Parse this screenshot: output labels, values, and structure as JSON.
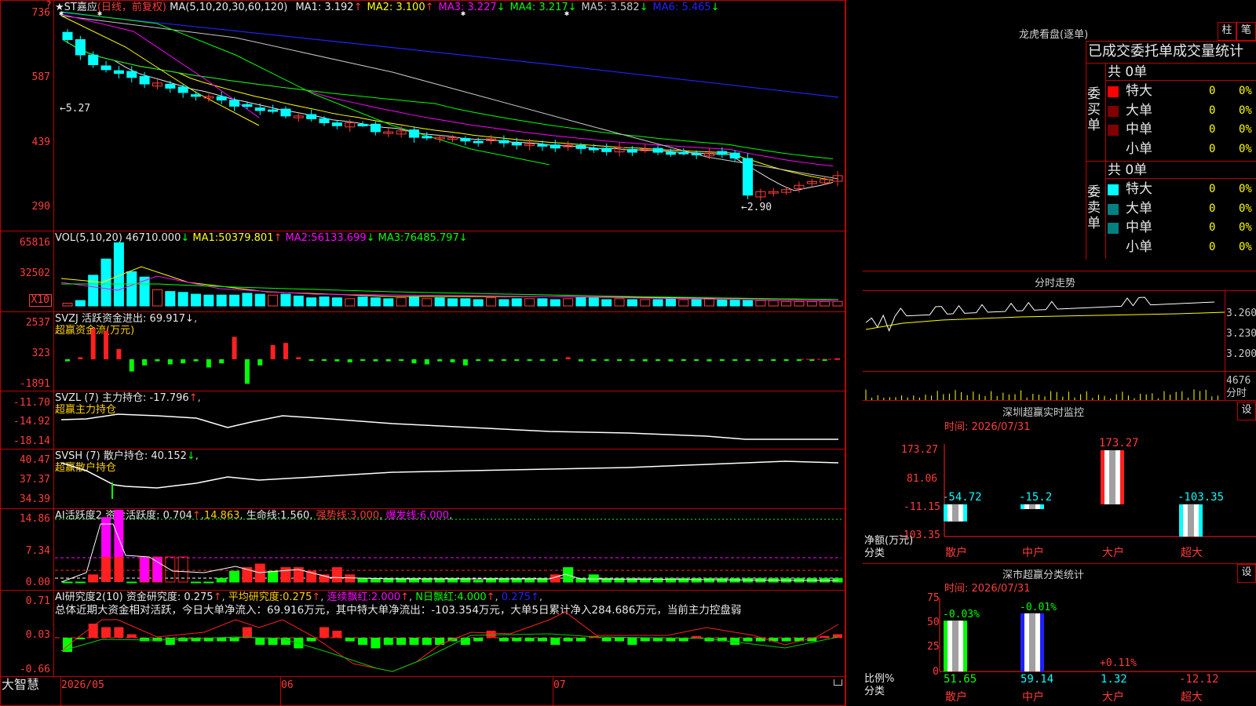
{
  "stock": {
    "title": "★ST嘉应",
    "period": "(日线，前复权)",
    "ma_label": "MA(5,10,20,30,60,120)",
    "ma": [
      {
        "name": "MA1:",
        "val": "3.192",
        "arrow": "↑",
        "color": "#e8e8e8"
      },
      {
        "name": "MA2:",
        "val": "3.100",
        "arrow": "↑",
        "color": "#ffff00"
      },
      {
        "name": "MA3:",
        "val": "3.227",
        "arrow": "↓",
        "color": "#ff00ff"
      },
      {
        "name": "MA4:",
        "val": "3.217",
        "arrow": "↓",
        "color": "#00ff00"
      },
      {
        "name": "MA5:",
        "val": "3.582",
        "arrow": "↓",
        "color": "#c8c8c8"
      },
      {
        "name": "MA6:",
        "val": "5.465",
        "arrow": "↓",
        "color": "#2222ff"
      }
    ],
    "y_ticks": [
      "736",
      "587",
      "439",
      "290"
    ],
    "high_label": "5.27",
    "low_label": "2.90",
    "corner_mark": "?"
  },
  "vol": {
    "label": "VOL(5,10,20)",
    "value": "46710.000",
    "arrow": "↓",
    "ma1": {
      "name": "MA1:",
      "val": "50379.801",
      "arrow": "↑"
    },
    "ma2": {
      "name": "MA2:",
      "val": "56133.699",
      "arrow": "↓"
    },
    "ma3": {
      "name": "MA3:",
      "val": "76485.797",
      "arrow": "↓"
    },
    "y_ticks": [
      "65816",
      "32502"
    ],
    "unit": "X10"
  },
  "svzj": {
    "label": "SVZJ  活跃资金进出:",
    "value": "69.917",
    "arrow": "↓",
    "sub": "超赢资金流(万元)",
    "y_ticks": [
      "2537",
      "323",
      "-1891"
    ]
  },
  "svzl": {
    "label": "SVZL (7) 主力持仓:",
    "value": "-17.796",
    "arrow": "↑",
    "sub": "超赢主力持仓",
    "y_ticks": [
      "-11.70",
      "-14.92",
      "-18.14"
    ]
  },
  "svsh": {
    "label": "SVSH (7) 散户持仓:",
    "value": "40.152",
    "arrow": "↓",
    "sub": "超赢散户持仓",
    "y_ticks": [
      "40.47",
      "37.37",
      "34.39"
    ]
  },
  "ai_active": {
    "label": "AI活跃度2 资金活跃度:",
    "value": "0.704",
    "arrow": "↑",
    "v2": "14.863",
    "life": "生命线:",
    "life_val": "1.560",
    "strong": "强势线:",
    "strong_val": "3.000",
    "burst": "爆发线:",
    "burst_val": "6.000",
    "y_ticks": [
      "14.86",
      "7.34",
      "0.00"
    ]
  },
  "ai_research": {
    "label": "AI研究度2(10) 资金研究度:",
    "value": "0.275",
    "arrow": "↑",
    "avg": "平均研究度:",
    "avg_val": "0.275",
    "cont": "连续飘红:",
    "cont_val": "2.000",
    "nday": "N日飘红:",
    "nday_val": "4.000",
    "last": "0.275",
    "y_ticks": [
      "0.71",
      "0.03",
      "-0.66"
    ],
    "summary": "总体近期大资金相对活跃，今日大单净流入：69.916万元，其中特大单净流出：-103.354万元，大单5日累计净入284.686万元，当前主力控盘弱"
  },
  "bottom": {
    "brand": "大智慧",
    "dates": [
      "2026/05",
      "06",
      "07"
    ]
  },
  "dragon": {
    "title": "龙虎看盘(逐单)",
    "btn_bar": "柱",
    "btn_pen": "笔",
    "header": "已成交委托单成交量统计",
    "buy_label": "委买单",
    "sell_label": "委卖单",
    "buy_total": "共 0单",
    "sell_total": "共 0单",
    "buy": [
      {
        "name": "特大",
        "count": "0",
        "pct": "0%",
        "color": "#ff0000"
      },
      {
        "name": "大单",
        "count": "0",
        "pct": "0%",
        "color": "#800000"
      },
      {
        "name": "中单",
        "count": "0",
        "pct": "0%",
        "color": "#800000"
      },
      {
        "name": "小单",
        "count": "0",
        "pct": "0%",
        "color": "#000000"
      }
    ],
    "sell": [
      {
        "name": "特大",
        "count": "0",
        "pct": "0%",
        "color": "#00ffff"
      },
      {
        "name": "大单",
        "count": "0",
        "pct": "0%",
        "color": "#008080"
      },
      {
        "name": "中单",
        "count": "0",
        "pct": "0%",
        "color": "#008080"
      },
      {
        "name": "小单",
        "count": "0",
        "pct": "0%",
        "color": "#000000"
      }
    ]
  },
  "intraday": {
    "title": "分时走势",
    "y_ticks": [
      "3.260",
      "3.230",
      "3.200"
    ],
    "vol_tick": "4676",
    "vol_unit": "分时"
  },
  "sz_monitor": {
    "title": "深圳超赢实时监控",
    "btn": "设",
    "time": "时间: 2026/07/31",
    "y_ticks": [
      "173.27",
      "81.06",
      "-11.15",
      "-103.35"
    ],
    "ylabel": "净额(万元)",
    "xlabel": "分类",
    "categories": [
      "散户",
      "中户",
      "大户",
      "超大"
    ],
    "values": [
      -54.72,
      -15.2,
      173.27,
      -103.35
    ],
    "value_labels": [
      "-54.72",
      "-15.2",
      "173.27",
      "-103.35"
    ]
  },
  "sz_class": {
    "title": "深市超赢分类统计",
    "btn": "设",
    "time": "时间: 2026/07/31",
    "y_ticks": [
      "75",
      "50",
      "25",
      "0"
    ],
    "ylabel": "比例%",
    "xlabel": "分类",
    "categories": [
      "散户",
      "中户",
      "大户",
      "超大"
    ],
    "values": [
      51.65,
      59.14,
      1.32,
      12.12
    ],
    "value_labels": [
      "51.65",
      "59.14",
      "1.32",
      "-12.12"
    ],
    "top_labels": [
      "-0.03%",
      "-0.01%",
      "+0.11%",
      ""
    ]
  }
}
